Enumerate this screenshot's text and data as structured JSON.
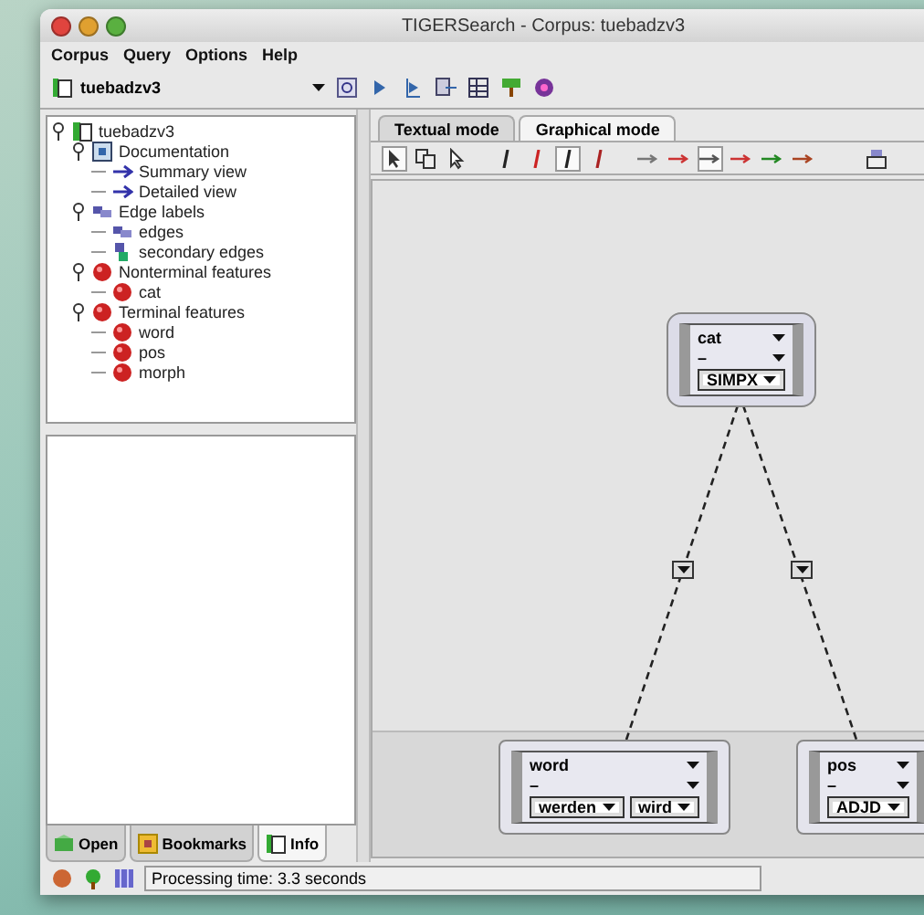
{
  "window": {
    "title": "TIGERSearch - Corpus: tuebadzv3"
  },
  "menu": [
    "Corpus",
    "Query",
    "Options",
    "Help"
  ],
  "corpus_selector": {
    "value": "tuebadzv3"
  },
  "tree": [
    {
      "label": "tuebadzv3",
      "kind": "corpus",
      "expanded": true,
      "children": [
        {
          "label": "Documentation",
          "kind": "doc",
          "expanded": true,
          "children": [
            {
              "label": "Summary view",
              "kind": "view"
            },
            {
              "label": "Detailed view",
              "kind": "view"
            }
          ]
        },
        {
          "label": "Edge labels",
          "kind": "edge",
          "expanded": true,
          "children": [
            {
              "label": "edges",
              "kind": "edge"
            },
            {
              "label": "secondary edges",
              "kind": "secedge"
            }
          ]
        },
        {
          "label": "Nonterminal features",
          "kind": "feature",
          "expanded": true,
          "children": [
            {
              "label": "cat",
              "kind": "feature"
            }
          ]
        },
        {
          "label": "Terminal features",
          "kind": "feature",
          "expanded": true,
          "children": [
            {
              "label": "word",
              "kind": "feature"
            },
            {
              "label": "pos",
              "kind": "feature"
            },
            {
              "label": "morph",
              "kind": "feature"
            }
          ]
        }
      ]
    }
  ],
  "left_tabs": [
    {
      "label": "Open",
      "kind": "open",
      "selected": false
    },
    {
      "label": "Bookmarks",
      "kind": "bookmarks",
      "selected": false
    },
    {
      "label": "Info",
      "kind": "info",
      "selected": true
    }
  ],
  "status_bar": {
    "text": "Processing time: 3.3 seconds"
  },
  "mode_tabs": [
    {
      "label": "Textual mode",
      "selected": false
    },
    {
      "label": "Graphical mode",
      "selected": true
    }
  ],
  "tools": [
    {
      "kind": "bar",
      "color": "#222222",
      "selected": false
    },
    {
      "kind": "bar",
      "color": "#cc2222",
      "selected": false
    },
    {
      "kind": "bar",
      "color": "#222222",
      "selected": true
    },
    {
      "kind": "bar",
      "color": "#aa2222",
      "selected": false
    },
    {
      "kind": "arrow",
      "color": "#777777",
      "selected": false
    },
    {
      "kind": "arrow",
      "color": "#cc3333",
      "selected": false
    },
    {
      "kind": "arrow",
      "color": "#555555",
      "selected": true
    },
    {
      "kind": "arrow",
      "color": "#cc3333",
      "selected": false
    },
    {
      "kind": "arrow",
      "color": "#228822",
      "selected": false
    },
    {
      "kind": "arrow",
      "color": "#aa4422",
      "selected": false
    }
  ],
  "graph": {
    "nodes": [
      {
        "kind": "nonterminal",
        "feature": "cat",
        "operator": "–",
        "values": [
          "SIMPX"
        ]
      },
      {
        "kind": "terminal",
        "feature": "word",
        "operator": "–",
        "values": [
          "werden",
          "wird"
        ]
      },
      {
        "kind": "terminal",
        "feature": "pos",
        "operator": "–",
        "values": [
          "ADJD"
        ]
      }
    ]
  }
}
